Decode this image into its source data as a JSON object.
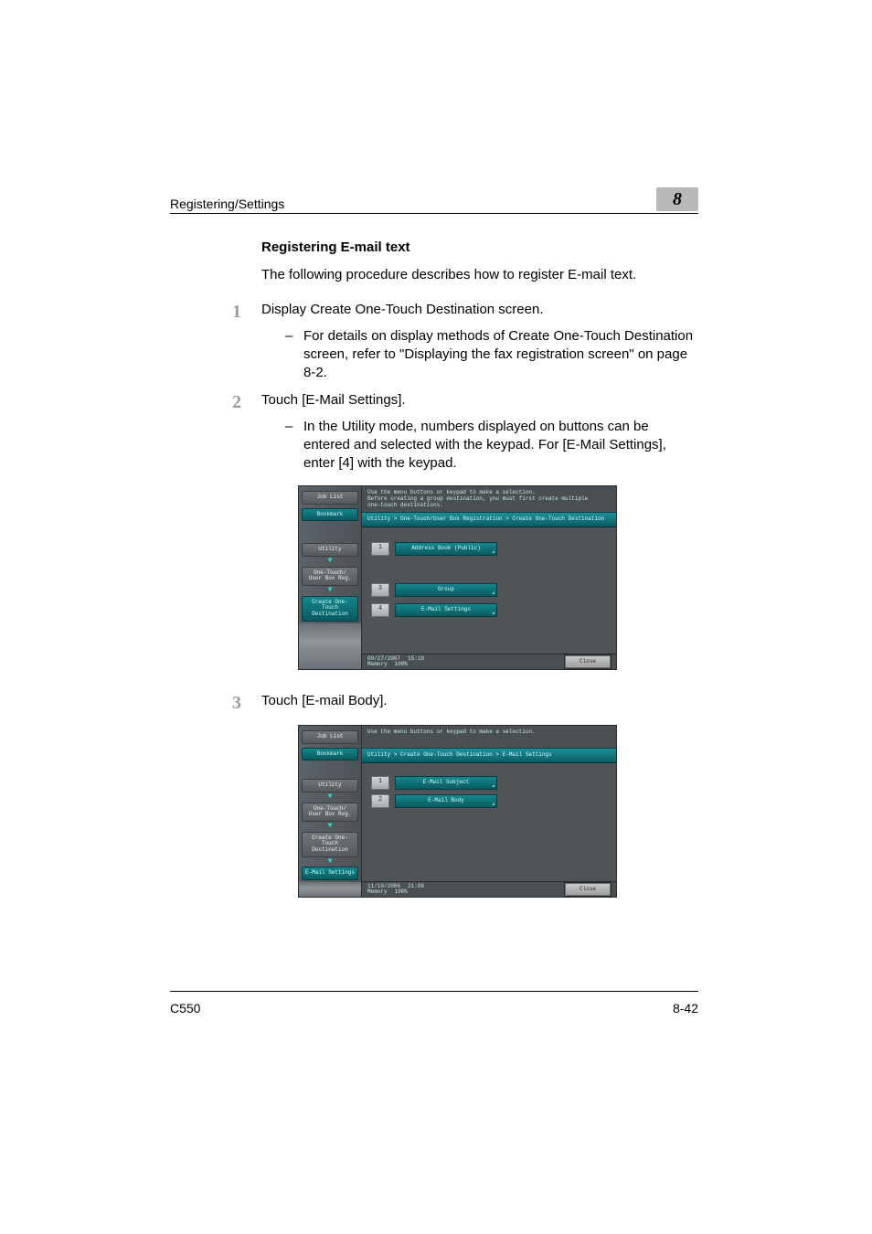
{
  "header": {
    "section": "Registering/Settings",
    "chapter": "8"
  },
  "heading": "Registering E-mail text",
  "intro": "The following procedure describes how to register E-mail text.",
  "steps": {
    "s1": {
      "num": "1",
      "text": "Display Create One-Touch Destination screen.",
      "sub": "For details on display methods of Create One-Touch Destination screen, refer to \"Displaying the fax registration screen\" on page 8-2."
    },
    "s2": {
      "num": "2",
      "text": "Touch [E-Mail Settings].",
      "sub": "In the Utility mode, numbers displayed on buttons can be entered and selected with the keypad. For [E-Mail Settings], enter [4] with the keypad."
    },
    "s3": {
      "num": "3",
      "text": "Touch [E-mail Body]."
    }
  },
  "screen1": {
    "msg": "Use the menu buttons or keypad to make a selection.\nBefore creating a group destination, you must first create multiple\none-touch destinations.",
    "breadcrumb": "Utility > One-Touch/User Box Registration > Create One-Touch Destination",
    "tabs": {
      "joblist": "Job List",
      "bookmark": "Bookmark",
      "utility": "Utility",
      "onetouch": "One-Touch/\nUser Box Reg.",
      "create": "Create One-Touch\nDestination"
    },
    "rows": {
      "r1": {
        "num": "1",
        "label": "Address Book (Public)"
      },
      "r3": {
        "num": "3",
        "label": "Group"
      },
      "r4": {
        "num": "4",
        "label": "E-Mail Settings"
      }
    },
    "footer": {
      "date": "09/27/2007",
      "time": "15:19",
      "mem_label": "Memory",
      "mem_val": "100%",
      "close": "Close"
    }
  },
  "screen2": {
    "msg": "Use the menu buttons or keypad to make a selection.",
    "breadcrumb": "Utility > Create One-Touch Destination > E-Mail Settings",
    "tabs": {
      "joblist": "Job List",
      "bookmark": "Bookmark",
      "utility": "Utility",
      "onetouch": "One-Touch/\nUser Box Reg.",
      "create": "Create One-Touch\nDestination",
      "email": "E-Mail Settings"
    },
    "rows": {
      "r1": {
        "num": "1",
        "label": "E-Mail Subject"
      },
      "r2": {
        "num": "2",
        "label": "E-Mail Body"
      }
    },
    "footer": {
      "date": "11/10/2006",
      "time": "21:08",
      "mem_label": "Memory",
      "mem_val": "100%",
      "close": "Close"
    }
  },
  "footer": {
    "model": "C550",
    "page": "8-42"
  }
}
